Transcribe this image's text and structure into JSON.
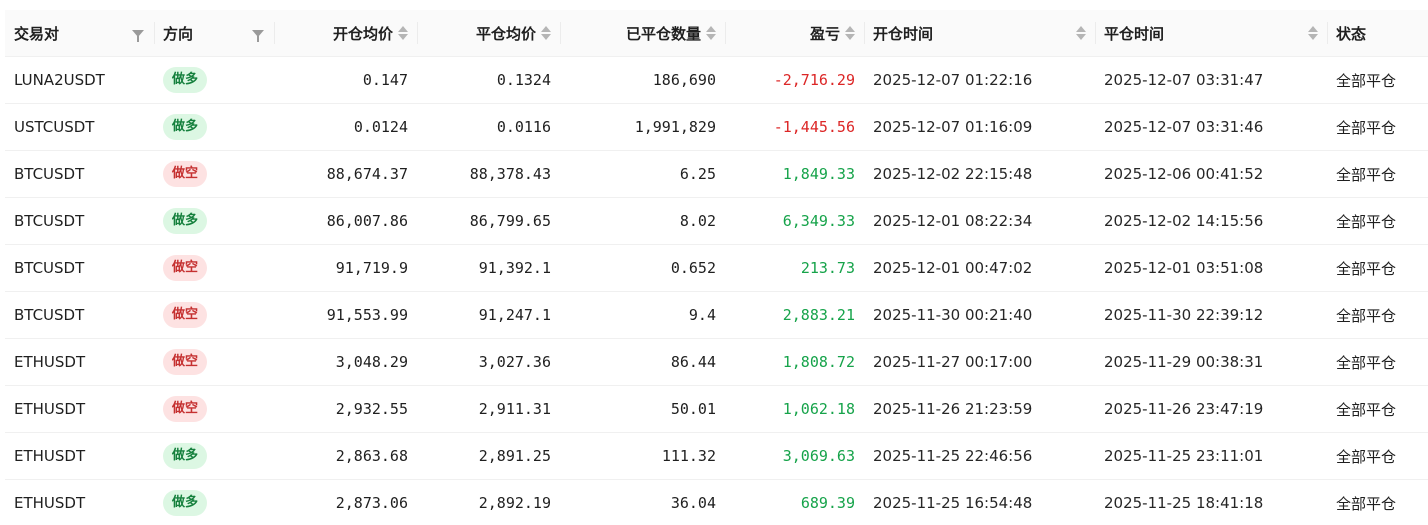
{
  "colors": {
    "profit": "#16a34a",
    "loss": "#dc2626",
    "long_bg": "#dcf7e3",
    "long_fg": "#15803d",
    "short_bg": "#fde2e2",
    "short_fg": "#c53030"
  },
  "table": {
    "headers": {
      "pair": "交易对",
      "direction": "方向",
      "open_avg": "开仓均价",
      "close_avg": "平仓均价",
      "closed_qty": "已平仓数量",
      "pnl": "盈亏",
      "open_time": "开仓时间",
      "close_time": "平仓时间",
      "status": "状态"
    },
    "rows": [
      {
        "pair": "LUNA2USDT",
        "direction": "做多",
        "side": "long",
        "open_avg": "0.147",
        "close_avg": "0.1324",
        "closed_qty": "186,690",
        "pnl": "-2,716.29",
        "pnl_sign": "neg",
        "open_time": "2025-12-07 01:22:16",
        "close_time": "2025-12-07 03:31:47",
        "status": "全部平仓"
      },
      {
        "pair": "USTCUSDT",
        "direction": "做多",
        "side": "long",
        "open_avg": "0.0124",
        "close_avg": "0.0116",
        "closed_qty": "1,991,829",
        "pnl": "-1,445.56",
        "pnl_sign": "neg",
        "open_time": "2025-12-07 01:16:09",
        "close_time": "2025-12-07 03:31:46",
        "status": "全部平仓"
      },
      {
        "pair": "BTCUSDT",
        "direction": "做空",
        "side": "short",
        "open_avg": "88,674.37",
        "close_avg": "88,378.43",
        "closed_qty": "6.25",
        "pnl": "1,849.33",
        "pnl_sign": "pos",
        "open_time": "2025-12-02 22:15:48",
        "close_time": "2025-12-06 00:41:52",
        "status": "全部平仓"
      },
      {
        "pair": "BTCUSDT",
        "direction": "做多",
        "side": "long",
        "open_avg": "86,007.86",
        "close_avg": "86,799.65",
        "closed_qty": "8.02",
        "pnl": "6,349.33",
        "pnl_sign": "pos",
        "open_time": "2025-12-01 08:22:34",
        "close_time": "2025-12-02 14:15:56",
        "status": "全部平仓"
      },
      {
        "pair": "BTCUSDT",
        "direction": "做空",
        "side": "short",
        "open_avg": "91,719.9",
        "close_avg": "91,392.1",
        "closed_qty": "0.652",
        "pnl": "213.73",
        "pnl_sign": "pos",
        "open_time": "2025-12-01 00:47:02",
        "close_time": "2025-12-01 03:51:08",
        "status": "全部平仓"
      },
      {
        "pair": "BTCUSDT",
        "direction": "做空",
        "side": "short",
        "open_avg": "91,553.99",
        "close_avg": "91,247.1",
        "closed_qty": "9.4",
        "pnl": "2,883.21",
        "pnl_sign": "pos",
        "open_time": "2025-11-30 00:21:40",
        "close_time": "2025-11-30 22:39:12",
        "status": "全部平仓"
      },
      {
        "pair": "ETHUSDT",
        "direction": "做空",
        "side": "short",
        "open_avg": "3,048.29",
        "close_avg": "3,027.36",
        "closed_qty": "86.44",
        "pnl": "1,808.72",
        "pnl_sign": "pos",
        "open_time": "2025-11-27 00:17:00",
        "close_time": "2025-11-29 00:38:31",
        "status": "全部平仓"
      },
      {
        "pair": "ETHUSDT",
        "direction": "做空",
        "side": "short",
        "open_avg": "2,932.55",
        "close_avg": "2,911.31",
        "closed_qty": "50.01",
        "pnl": "1,062.18",
        "pnl_sign": "pos",
        "open_time": "2025-11-26 21:23:59",
        "close_time": "2025-11-26 23:47:19",
        "status": "全部平仓"
      },
      {
        "pair": "ETHUSDT",
        "direction": "做多",
        "side": "long",
        "open_avg": "2,863.68",
        "close_avg": "2,891.25",
        "closed_qty": "111.32",
        "pnl": "3,069.63",
        "pnl_sign": "pos",
        "open_time": "2025-11-25 22:46:56",
        "close_time": "2025-11-25 23:11:01",
        "status": "全部平仓"
      },
      {
        "pair": "ETHUSDT",
        "direction": "做多",
        "side": "long",
        "open_avg": "2,873.06",
        "close_avg": "2,892.19",
        "closed_qty": "36.04",
        "pnl": "689.39",
        "pnl_sign": "pos",
        "open_time": "2025-11-25 16:54:48",
        "close_time": "2025-11-25 18:41:18",
        "status": "全部平仓"
      }
    ]
  }
}
